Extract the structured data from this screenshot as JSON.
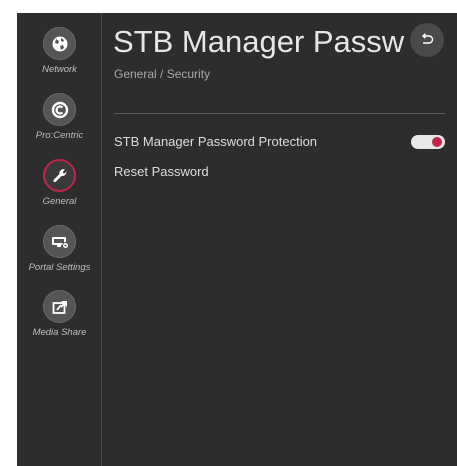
{
  "header": {
    "title": "STB Manager Passwo",
    "breadcrumb": "General / Security"
  },
  "sidebar": {
    "items": [
      {
        "label": "Network",
        "icon": "network-globe-icon",
        "active": false
      },
      {
        "label": "Pro:Centric",
        "icon": "procentric-icon",
        "active": false
      },
      {
        "label": "General",
        "icon": "wrench-icon",
        "active": true
      },
      {
        "label": "Portal Settings",
        "icon": "portal-settings-icon",
        "active": false
      },
      {
        "label": "Media Share",
        "icon": "media-share-icon",
        "active": false
      }
    ]
  },
  "settings": {
    "items": [
      {
        "label": "STB Manager Password Protection",
        "toggle": true,
        "value": "on"
      },
      {
        "label": "Reset Password"
      }
    ]
  },
  "colors": {
    "background": "#2d2d2d",
    "accent": "#c0254a",
    "text": "#dcdcdc"
  }
}
